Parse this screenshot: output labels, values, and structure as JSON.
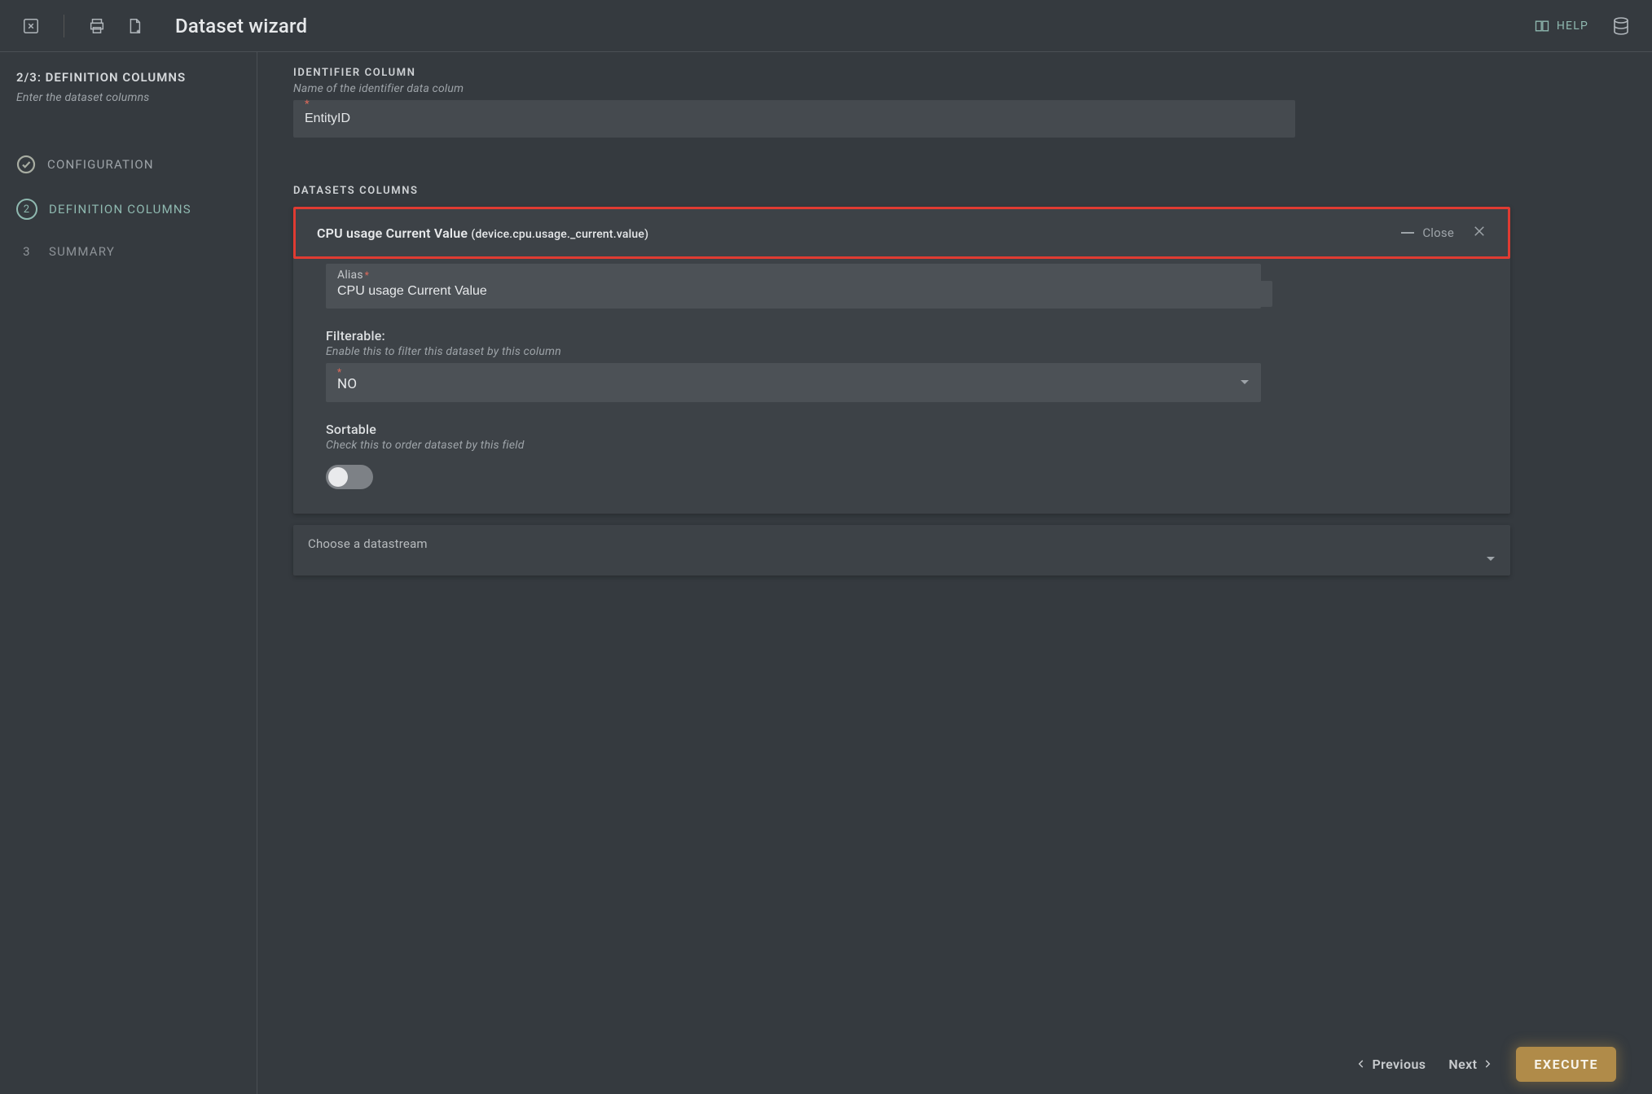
{
  "topbar": {
    "title": "Dataset wizard",
    "help_label": "HELP"
  },
  "sidebar": {
    "progress_title": "2/3: DEFINITION COLUMNS",
    "progress_sub": "Enter the dataset columns",
    "steps": {
      "configuration": "CONFIGURATION",
      "definition": "DEFINITION COLUMNS",
      "summary": "SUMMARY",
      "step2_num": "2",
      "step3_num": "3"
    }
  },
  "identifier": {
    "section_label": "IDENTIFIER COLUMN",
    "section_desc": "Name of the identifier data colum",
    "value": "EntityID"
  },
  "datasets": {
    "section_label": "DATASETS COLUMNS",
    "panel": {
      "title_main": "CPU usage Current Value",
      "title_path": "(device.cpu.usage._current.value)",
      "close_label": "Close",
      "alias_label": "Alias",
      "alias_value": "CPU usage Current Value",
      "filterable_label": "Filterable:",
      "filterable_desc": "Enable this to filter this dataset by this column",
      "filterable_value": "NO",
      "sortable_label": "Sortable",
      "sortable_desc": "Check this to order dataset by this field"
    },
    "choose_label": "Choose a datastream"
  },
  "footer": {
    "previous": "Previous",
    "next": "Next",
    "execute": "EXECUTE"
  }
}
